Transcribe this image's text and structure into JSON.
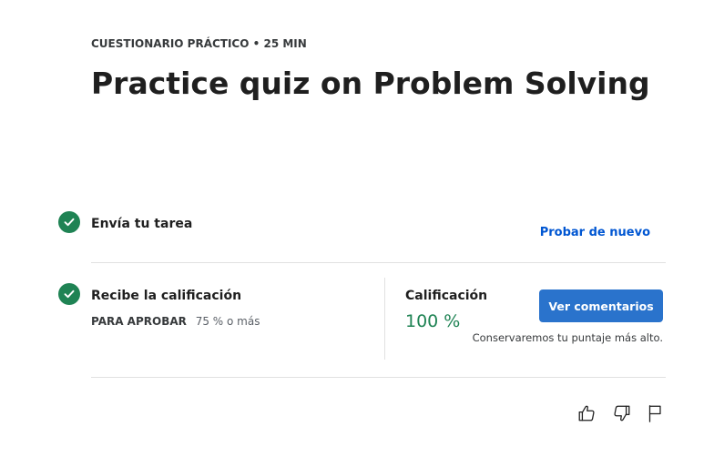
{
  "header": {
    "eyebrow": "CUESTIONARIO PRÁCTICO • 25 MIN",
    "title": "Practice quiz on Problem Solving"
  },
  "steps": {
    "submit": {
      "label": "Envía tu tarea",
      "action_label": "Probar de nuevo",
      "status_icon": "check-circle-icon"
    },
    "grade": {
      "label": "Recibe la calificación",
      "pass_label": "PARA APROBAR",
      "pass_value": "75 % o más",
      "status_icon": "check-circle-icon"
    }
  },
  "result": {
    "label": "Calificación",
    "value": "100 %",
    "button_label": "Ver comentarios",
    "note": "Conservaremos tu puntaje más alto."
  },
  "feedback": {
    "icons": [
      "thumbs-up-icon",
      "thumbs-down-icon",
      "flag-icon"
    ]
  },
  "colors": {
    "accent": "#2a73cc",
    "link": "#0056d2",
    "success": "#1f8354",
    "divider": "#e1e1e1"
  }
}
